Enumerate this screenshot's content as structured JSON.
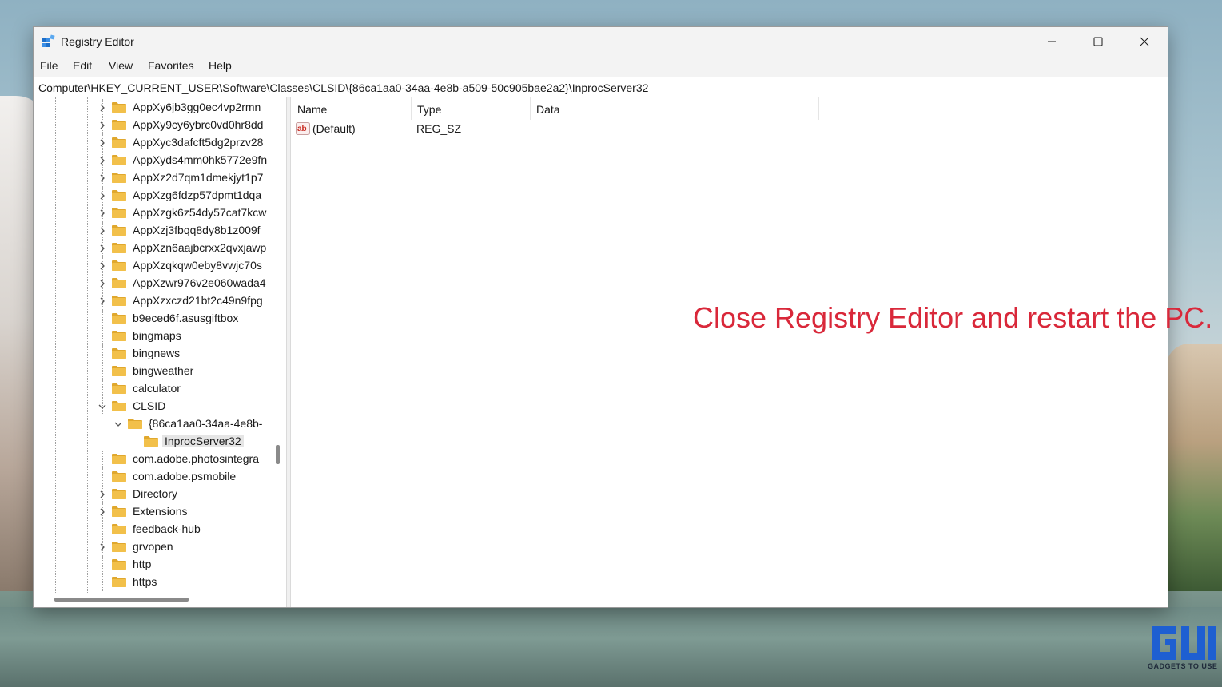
{
  "window": {
    "title": "Registry Editor"
  },
  "menu": [
    "File",
    "Edit",
    "View",
    "Favorites",
    "Help"
  ],
  "address": "Computer\\HKEY_CURRENT_USER\\Software\\Classes\\CLSID\\{86ca1aa0-34aa-4e8b-a509-50c905bae2a2}\\InprocServer32",
  "tree": [
    {
      "label": "AppXy6jb3gg0ec4vp2rmn",
      "expander": "collapsed"
    },
    {
      "label": "AppXy9cy6ybrc0vd0hr8dd",
      "expander": "collapsed"
    },
    {
      "label": "AppXyc3dafcft5dg2przv28",
      "expander": "collapsed"
    },
    {
      "label": "AppXyds4mm0hk5772e9fn",
      "expander": "collapsed"
    },
    {
      "label": "AppXz2d7qm1dmekjyt1p7",
      "expander": "collapsed"
    },
    {
      "label": "AppXzg6fdzp57dpmt1dqa",
      "expander": "collapsed"
    },
    {
      "label": "AppXzgk6z54dy57cat7kcw",
      "expander": "collapsed"
    },
    {
      "label": "AppXzj3fbqq8dy8b1z009f",
      "expander": "collapsed"
    },
    {
      "label": "AppXzn6aajbcrxx2qvxjawp",
      "expander": "collapsed"
    },
    {
      "label": "AppXzqkqw0eby8vwjc70s",
      "expander": "collapsed"
    },
    {
      "label": "AppXzwr976v2e060wada4",
      "expander": "collapsed"
    },
    {
      "label": "AppXzxczd21bt2c49n9fpg",
      "expander": "collapsed"
    },
    {
      "label": "b9eced6f.asusgiftbox",
      "expander": "none"
    },
    {
      "label": "bingmaps",
      "expander": "none"
    },
    {
      "label": "bingnews",
      "expander": "none"
    },
    {
      "label": "bingweather",
      "expander": "none"
    },
    {
      "label": "calculator",
      "expander": "none"
    },
    {
      "label": "CLSID",
      "expander": "expanded"
    },
    {
      "label": "{86ca1aa0-34aa-4e8b-",
      "expander": "expanded",
      "level": 1
    },
    {
      "label": "InprocServer32",
      "expander": "none",
      "level": 2,
      "selected": true
    },
    {
      "label": "com.adobe.photosintegra",
      "expander": "none"
    },
    {
      "label": "com.adobe.psmobile",
      "expander": "none"
    },
    {
      "label": "Directory",
      "expander": "collapsed"
    },
    {
      "label": "Extensions",
      "expander": "collapsed"
    },
    {
      "label": "feedback-hub",
      "expander": "none"
    },
    {
      "label": "grvopen",
      "expander": "collapsed"
    },
    {
      "label": "http",
      "expander": "none"
    },
    {
      "label": "https",
      "expander": "none"
    }
  ],
  "list": {
    "columns": [
      "Name",
      "Type",
      "Data"
    ],
    "rows": [
      {
        "name": "(Default)",
        "type": "REG_SZ",
        "data": ""
      }
    ]
  },
  "annotation": "Close Registry Editor and restart the PC.",
  "watermark": "GADGETS TO USE",
  "colors": {
    "annotation": "#d9283a",
    "folder": "#f2c04a",
    "selection": "#e5e5e5"
  }
}
